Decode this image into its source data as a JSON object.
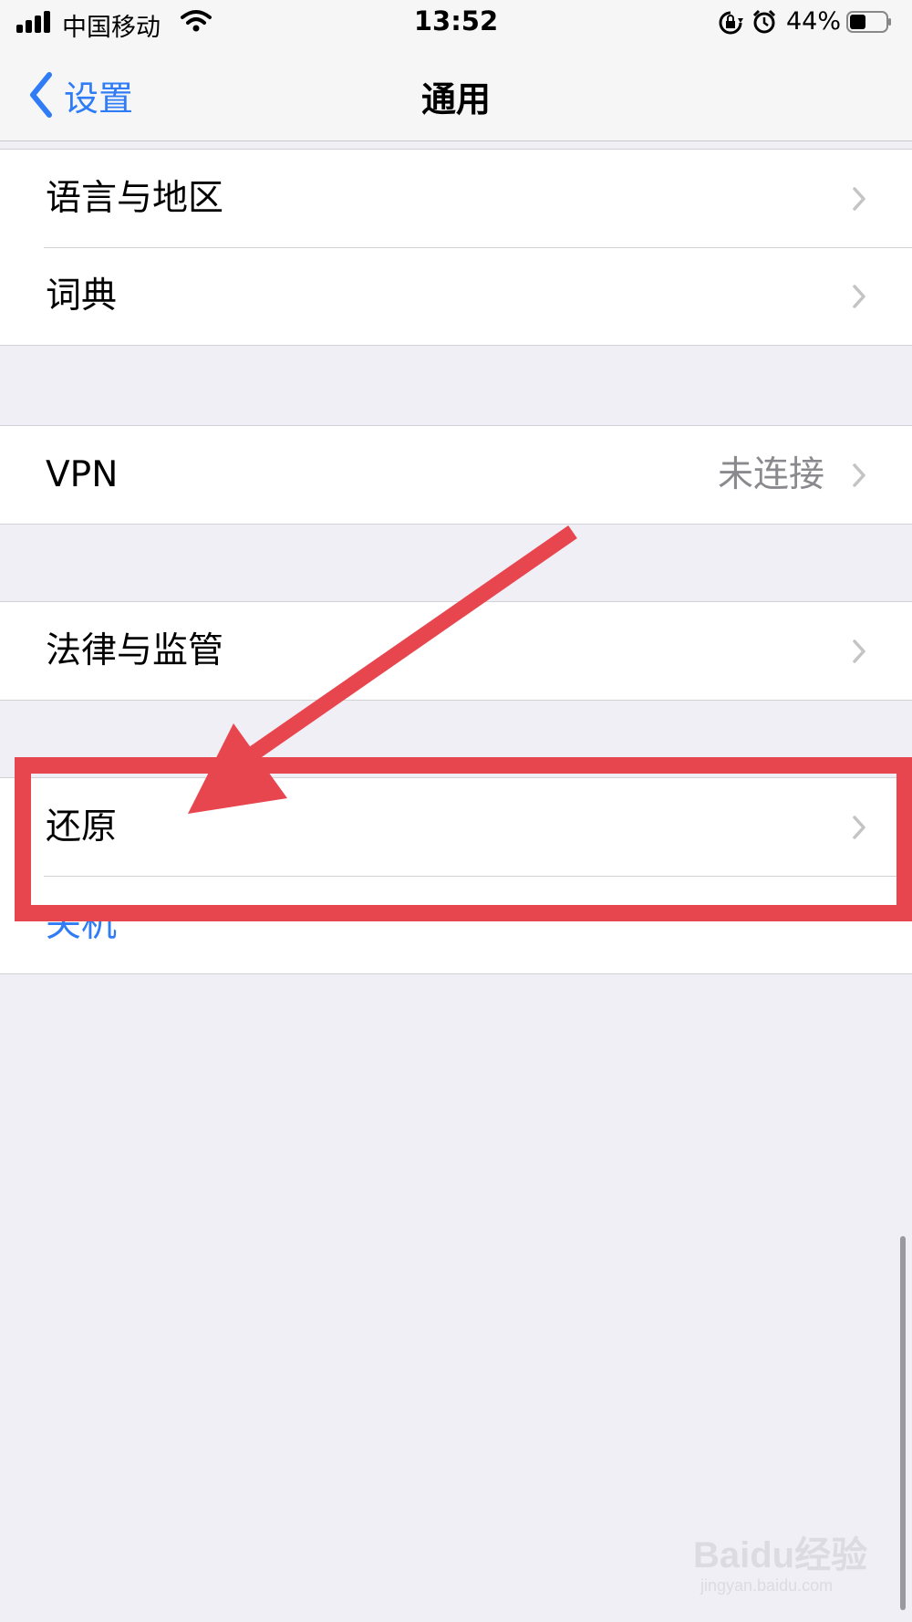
{
  "status_bar": {
    "carrier": "中国移动",
    "time": "13:52",
    "battery_percent": "44%",
    "battery_level": 0.44
  },
  "nav": {
    "back_label": "设置",
    "title": "通用"
  },
  "groups": [
    {
      "items": [
        {
          "label": "语言与地区"
        },
        {
          "label": "词典"
        }
      ]
    },
    {
      "items": [
        {
          "label": "VPN",
          "value": "未连接"
        }
      ]
    },
    {
      "items": [
        {
          "label": "法律与监管"
        }
      ]
    },
    {
      "items": [
        {
          "label": "还原"
        },
        {
          "label": "关机"
        }
      ]
    }
  ],
  "annotation": {
    "highlighted_item": "还原",
    "color": "#e8464f"
  },
  "colors": {
    "accent": "#2f7cf6",
    "background": "#f0eff5",
    "annotation": "#e8464f"
  },
  "watermark": {
    "brand": "Baidu经验",
    "url": "jingyan.baidu.com"
  }
}
